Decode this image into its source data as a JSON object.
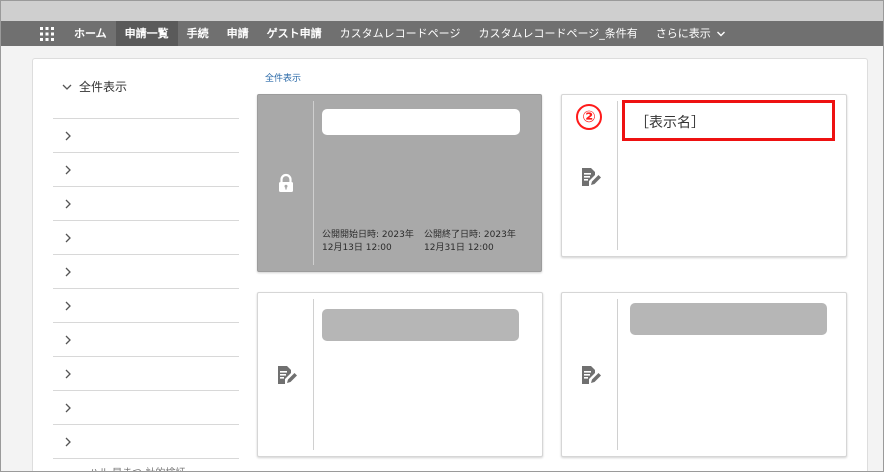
{
  "nav": {
    "items": [
      {
        "label": "ホーム",
        "active": false
      },
      {
        "label": "申請一覧",
        "active": true
      },
      {
        "label": "手続",
        "active": false
      },
      {
        "label": "申請",
        "active": false
      },
      {
        "label": "ゲスト申請",
        "active": false
      },
      {
        "label": "カスタムレコードページ",
        "active": false
      },
      {
        "label": "カスタムレコードページ_条件有",
        "active": false
      }
    ],
    "more_label": "さらに表示"
  },
  "sidebar": {
    "header": "全件表示",
    "rows": [
      "",
      "",
      "",
      "",
      "",
      "",
      "",
      "",
      "",
      ""
    ],
    "cut_text": "ハル 早まつ 計的検証"
  },
  "breadcrumb": "全件表示",
  "cards": [
    {
      "locked": true,
      "icon": "lock-icon",
      "start_label": "公開開始日時:",
      "start_value": "2023年12月13日 12:00",
      "end_label": "公開終了日時:",
      "end_value": "2023年12月31日 12:00"
    },
    {
      "locked": false,
      "icon": "document-edit-icon",
      "callout_number": "②",
      "callout_label": "［表示名］"
    },
    {
      "locked": false,
      "icon": "document-edit-icon"
    },
    {
      "locked": false,
      "icon": "document-edit-icon"
    }
  ],
  "colors": {
    "navbar": "#707070",
    "nav_active": "#5a5a5a",
    "locked_card": "#a9a9a9",
    "callout_red": "#ee1111",
    "link_blue": "#2b6aa8"
  }
}
